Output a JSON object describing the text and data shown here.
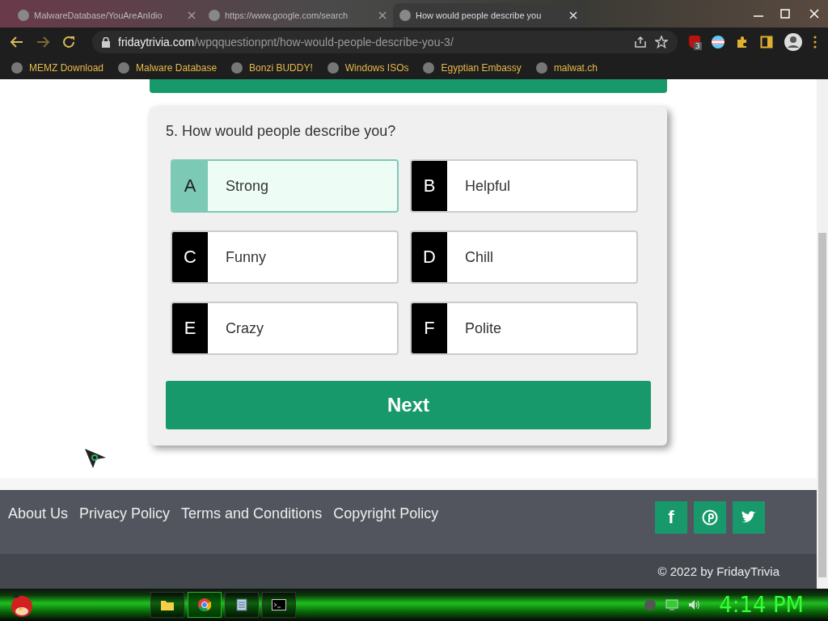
{
  "browser": {
    "tabs": [
      {
        "title": "MalwareDatabase/YouAreAnIdio",
        "selected": false
      },
      {
        "title": "https://www.google.com/search",
        "selected": false
      },
      {
        "title": "How would people describe you",
        "selected": true
      }
    ],
    "url": {
      "host": "fridaytrivia.com",
      "path": "/wpqquestionpnt/how-would-people-describe-you-3/"
    },
    "extension_badge": "3",
    "bookmarks": [
      "MEMZ Download",
      "Malware Database",
      "Bonzi BUDDY!",
      "Windows ISOs",
      "Egyptian Embassy",
      "malwat.ch"
    ]
  },
  "quiz": {
    "question": "5. How would people describe you?",
    "options": [
      {
        "letter": "A",
        "text": "Strong",
        "selected": true
      },
      {
        "letter": "B",
        "text": "Helpful",
        "selected": false
      },
      {
        "letter": "C",
        "text": "Funny",
        "selected": false
      },
      {
        "letter": "D",
        "text": "Chill",
        "selected": false
      },
      {
        "letter": "E",
        "text": "Crazy",
        "selected": false
      },
      {
        "letter": "F",
        "text": "Polite",
        "selected": false
      }
    ],
    "next_button": "Next"
  },
  "footer": {
    "links": [
      "About Us",
      "Privacy Policy",
      "Terms and Conditions",
      "Copyright Policy"
    ],
    "social": [
      {
        "kind": "facebook",
        "glyph": "f"
      },
      {
        "kind": "pinterest"
      },
      {
        "kind": "twitter"
      }
    ],
    "copyright": "© 2022 by FridayTrivia"
  },
  "taskbar": {
    "clock": "4:14 PM"
  }
}
